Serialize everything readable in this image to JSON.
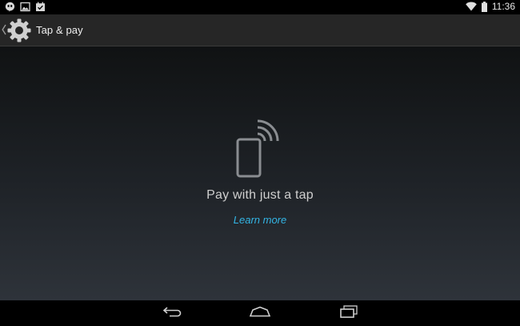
{
  "status_bar": {
    "notification_icons": [
      "hangouts-icon",
      "gallery-icon",
      "calendar-check-icon"
    ],
    "wifi_icon": "wifi-icon",
    "battery_icon": "battery-icon",
    "time": "11:36"
  },
  "action_bar": {
    "up_icon": "chevron-left-icon",
    "app_icon": "settings-gear-icon",
    "title": "Tap & pay"
  },
  "content": {
    "illustration_icon": "phone-nfc-icon",
    "headline": "Pay with just a tap",
    "link": "Learn more"
  },
  "nav_bar": {
    "buttons": [
      "back-icon",
      "home-icon",
      "recents-icon"
    ]
  },
  "colors": {
    "accent": "#33b5e5",
    "action_bar_bg": "#262626",
    "status_bar_bg": "#000000"
  }
}
